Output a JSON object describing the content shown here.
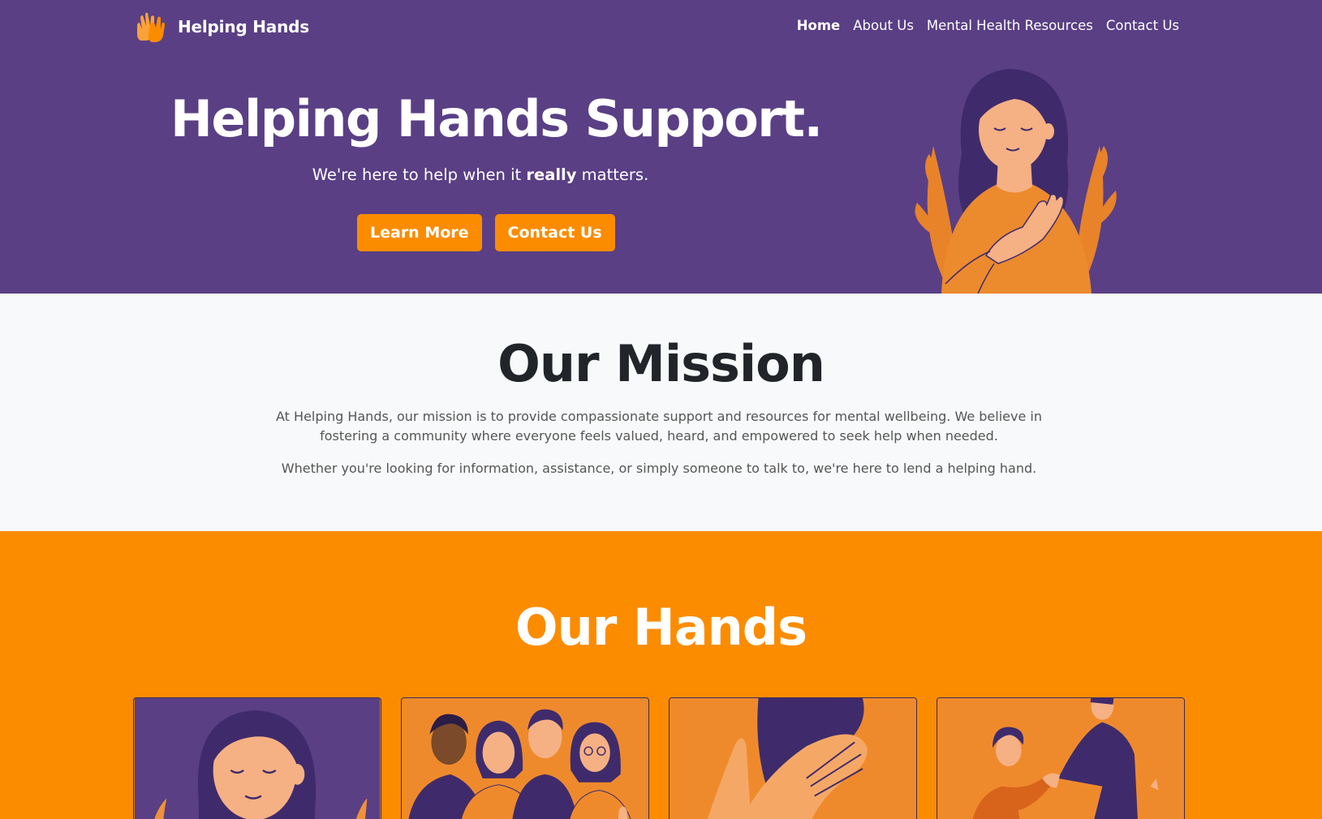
{
  "brand": {
    "name": "Helping Hands",
    "icon": "raised-hands-icon"
  },
  "nav": {
    "items": [
      {
        "label": "Home",
        "active": true
      },
      {
        "label": "About Us",
        "active": false
      },
      {
        "label": "Mental Health Resources",
        "active": false
      },
      {
        "label": "Contact Us",
        "active": false
      }
    ]
  },
  "hero": {
    "title": "Helping Hands Support.",
    "subtitle_pre": "We're here to help when it ",
    "subtitle_bold": "really",
    "subtitle_post": " matters.",
    "buttons": {
      "learn_more": "Learn More",
      "contact_us": "Contact Us"
    }
  },
  "mission": {
    "title": "Our Mission",
    "paragraph1": "At Helping Hands, our mission is to provide compassionate support and resources for mental wellbeing. We believe in fostering a community where everyone feels valued, heard, and empowered to seek help when needed.",
    "paragraph2": "Whether you're looking for information, assistance, or simply someone to talk to, we're here to lend a helping hand."
  },
  "hands": {
    "title": "Our Hands"
  },
  "colors": {
    "purple": "#5a3f85",
    "orange": "#fb8c00",
    "light_bg": "#f8f9fa"
  }
}
